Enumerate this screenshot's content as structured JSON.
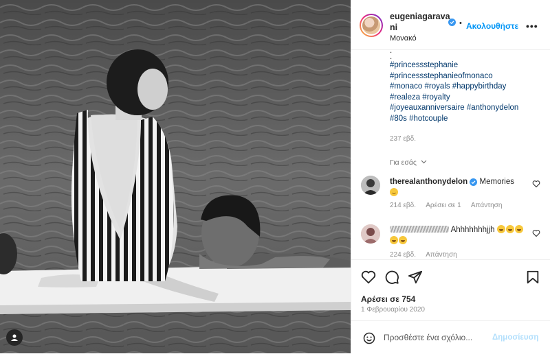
{
  "header": {
    "username": "eugeniagaravani",
    "follow_label": "Ακολουθήστε",
    "more_label": "•••",
    "location": "Μονακό"
  },
  "caption": {
    "dots": [
      ".",
      "."
    ],
    "hashtag_lines": [
      "#princessstephanie",
      "#princessstephanieofmonaco",
      "#monaco #royals #happybirthday",
      "#realeza #royalty",
      "#joyeauxanniversaire #anthonydelon",
      "#80s #hotcouple"
    ],
    "time": "237 εβδ."
  },
  "for_you_label": "Για εσάς",
  "comments": [
    {
      "username": "therealanthonydelon",
      "text": "Memories",
      "time": "214 εβδ.",
      "likes": "Αρέσει σε 1",
      "reply": "Απάντηση"
    },
    {
      "username": "",
      "text": "Ahhhhhhhjjh",
      "time": "224 εβδ.",
      "reply": "Απάντηση"
    }
  ],
  "actions": {
    "likes": "Αρέσει σε 754",
    "date": "1 Φεβρουαρίου 2020"
  },
  "add_comment": {
    "placeholder": "Προσθέστε ένα σχόλιο...",
    "post_label": "Δημοσίευση"
  },
  "colors": {
    "accent": "#0095f6",
    "verified": "#3897f0",
    "muted": "#8e8e8e",
    "hashtag": "#00376b"
  },
  "icons": [
    "user-tag-icon",
    "verified-icon",
    "more-icon",
    "chevron-down-icon",
    "heart-icon",
    "comment-icon",
    "share-icon",
    "bookmark-icon",
    "emoji-icon"
  ]
}
